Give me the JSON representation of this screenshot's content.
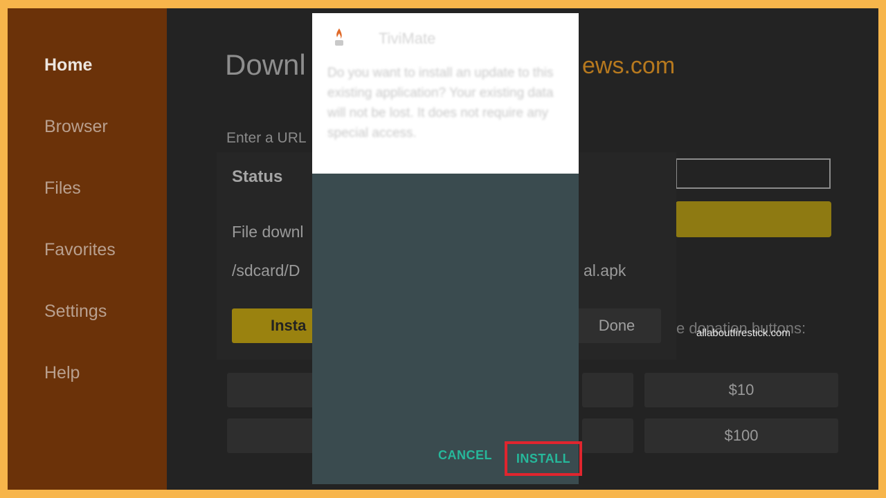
{
  "sidebar": {
    "items": [
      {
        "label": "Home",
        "active": true
      },
      {
        "label": "Browser",
        "active": false
      },
      {
        "label": "Files",
        "active": false
      },
      {
        "label": "Favorites",
        "active": false
      },
      {
        "label": "Settings",
        "active": false
      },
      {
        "label": "Help",
        "active": false
      }
    ]
  },
  "main": {
    "title_partial": "Downl",
    "site_partial": "ews.com",
    "url_label_partial": "Enter a URL",
    "donation_text_partial": "se donation buttons:",
    "donations": [
      "$10",
      "$100"
    ]
  },
  "status_dialog": {
    "title": "Status",
    "line1_partial": "File downl",
    "path_partial": "/sdcard/D",
    "apk_partial": "al.apk",
    "install_label_partial": "Insta",
    "done_label_partial": "Done"
  },
  "install_dialog": {
    "app_name": "TiviMate",
    "description": "Do you want to install an update to this existing application? Your existing data will not be lost. It does not require any special access.",
    "cancel_label": "CANCEL",
    "install_label": "INSTALL"
  },
  "watermark": "allaboutfirestick.com",
  "colors": {
    "frame": "#f7b54b",
    "sidebar": "#6b3209",
    "accent_button": "#26b89b",
    "highlight_box": "#e0252e"
  }
}
